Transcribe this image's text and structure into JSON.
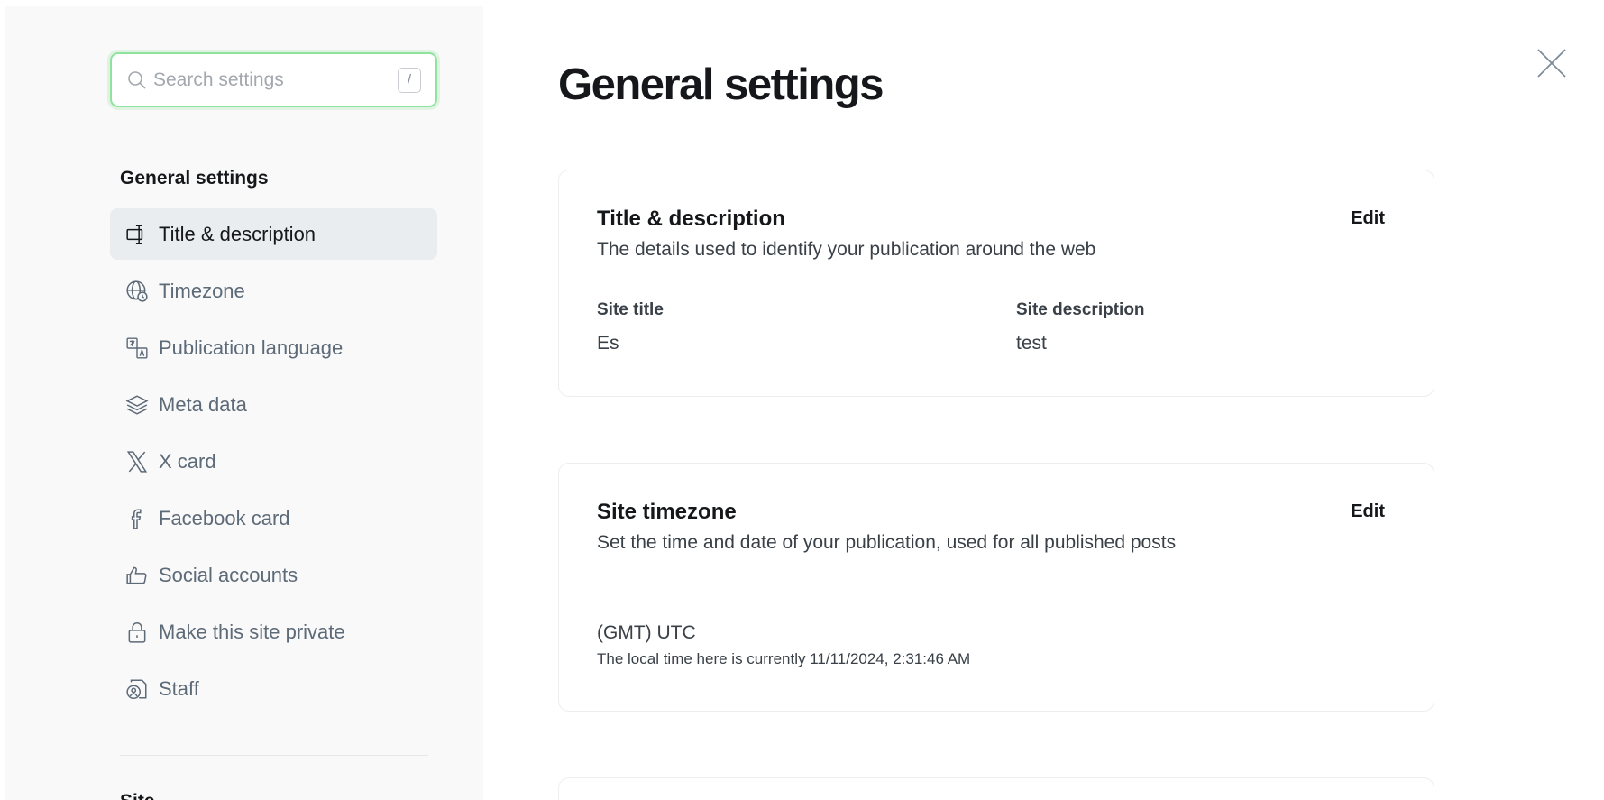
{
  "search": {
    "placeholder": "Search settings",
    "shortcut": "/"
  },
  "sidebar": {
    "heading": "General settings",
    "items": [
      {
        "label": "Title & description",
        "icon": "title-description-icon",
        "active": true
      },
      {
        "label": "Timezone",
        "icon": "globe-clock-icon",
        "active": false
      },
      {
        "label": "Publication language",
        "icon": "translate-icon",
        "active": false
      },
      {
        "label": "Meta data",
        "icon": "layers-icon",
        "active": false
      },
      {
        "label": "X card",
        "icon": "x-logo-icon",
        "active": false
      },
      {
        "label": "Facebook card",
        "icon": "facebook-icon",
        "active": false
      },
      {
        "label": "Social accounts",
        "icon": "thumbs-up-icon",
        "active": false
      },
      {
        "label": "Make this site private",
        "icon": "lock-icon",
        "active": false
      },
      {
        "label": "Staff",
        "icon": "staff-icon",
        "active": false
      }
    ],
    "next_heading": "Site"
  },
  "main": {
    "title": "General settings",
    "cards": [
      {
        "title": "Title & description",
        "description": "The details used to identify your publication around the web",
        "edit_label": "Edit",
        "fields": [
          {
            "label": "Site title",
            "value": "Es"
          },
          {
            "label": "Site description",
            "value": "test"
          }
        ]
      },
      {
        "title": "Site timezone",
        "description": "Set the time and date of your publication, used for all published posts",
        "edit_label": "Edit",
        "timezone": "(GMT) UTC",
        "local_time": "The local time here is currently 11/11/2024, 2:31:46 AM"
      }
    ]
  },
  "colors": {
    "accent": "#30cf43",
    "active_bg": "#eaedf0",
    "muted": "#5d6a78"
  }
}
